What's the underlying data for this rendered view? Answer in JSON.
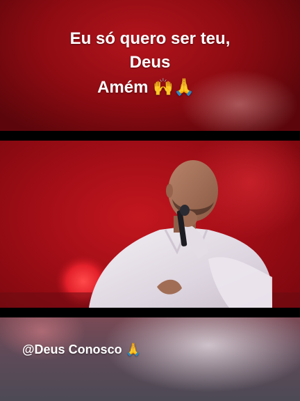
{
  "caption": {
    "line1": "Eu só quero ser teu,",
    "line2": "Deus",
    "line3": "Amém 🙌🙏"
  },
  "credit": {
    "text": "@Deus Conosco 🙏"
  },
  "colors": {
    "stage_red": "#b3141c",
    "text": "#ffffff",
    "letterbox": "#000000"
  }
}
